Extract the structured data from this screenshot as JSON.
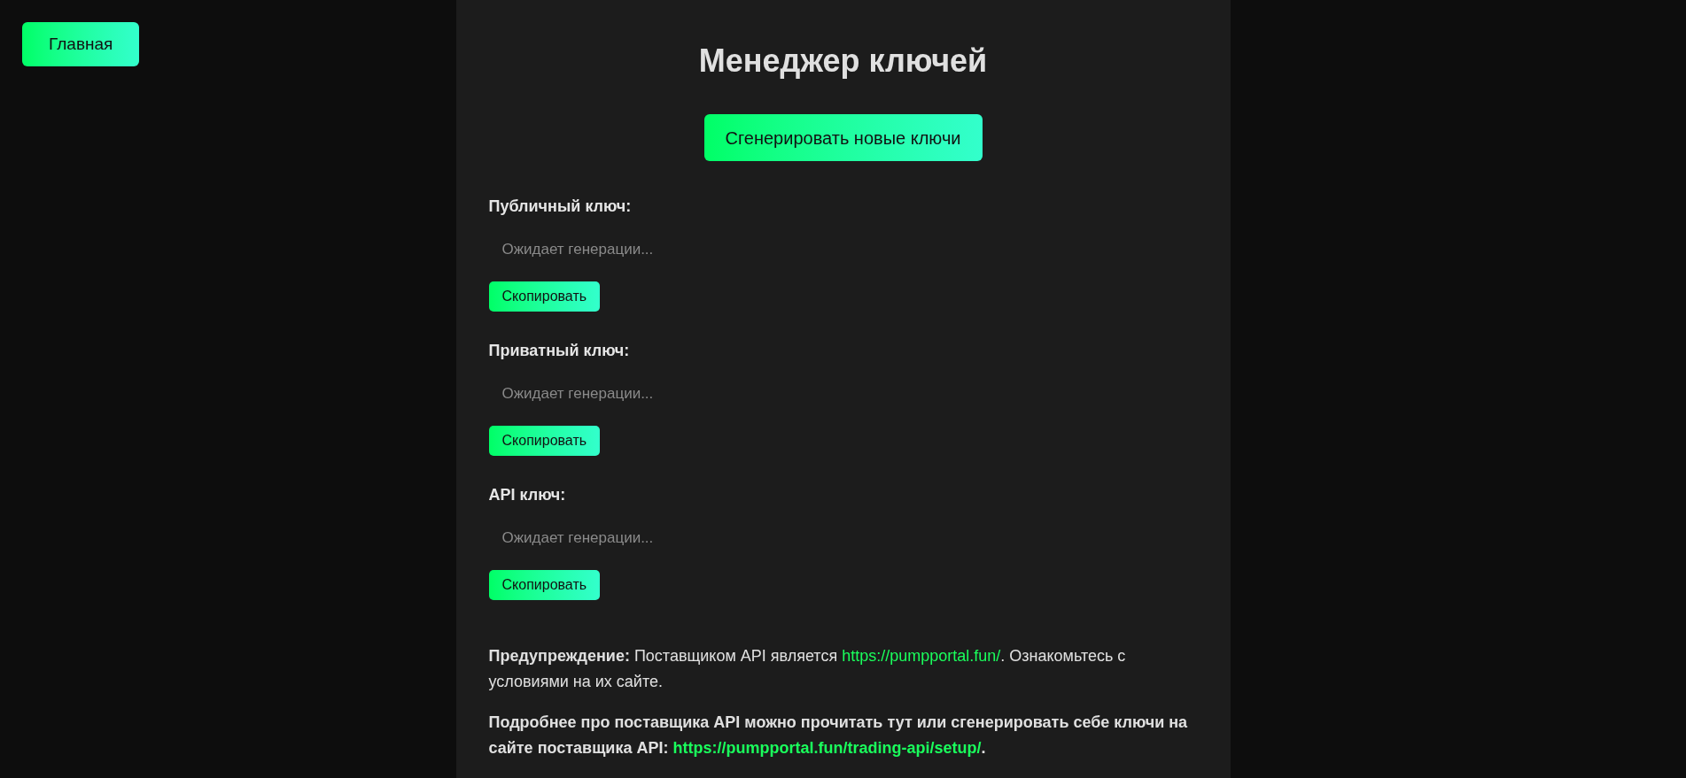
{
  "nav": {
    "home_button": "Главная"
  },
  "title": "Менеджер ключей",
  "generate_button": "Сгенерировать новые ключи",
  "keys": [
    {
      "label": "Публичный ключ:",
      "placeholder": "Ожидает генерации...",
      "copy_button": "Скопировать"
    },
    {
      "label": "Приватный ключ:",
      "placeholder": "Ожидает генерации...",
      "copy_button": "Скопировать"
    },
    {
      "label": "API ключ:",
      "placeholder": "Ожидает генерации...",
      "copy_button": "Скопировать"
    }
  ],
  "notes": [
    {
      "bold": false,
      "text": "**Предупреждение:** Поставщиком API является ",
      "link": "https://pumpportal.fun/",
      "after": ". Ознакомьтесь с условиями на их сайте."
    },
    {
      "bold": true,
      "text": "Подробнее про поставщика API можно прочитать тут или сгенерировать себе ключи на сайте поставщика API: ",
      "link": "https://pumpportal.fun/trading-api/setup/",
      "after": "."
    }
  ]
}
